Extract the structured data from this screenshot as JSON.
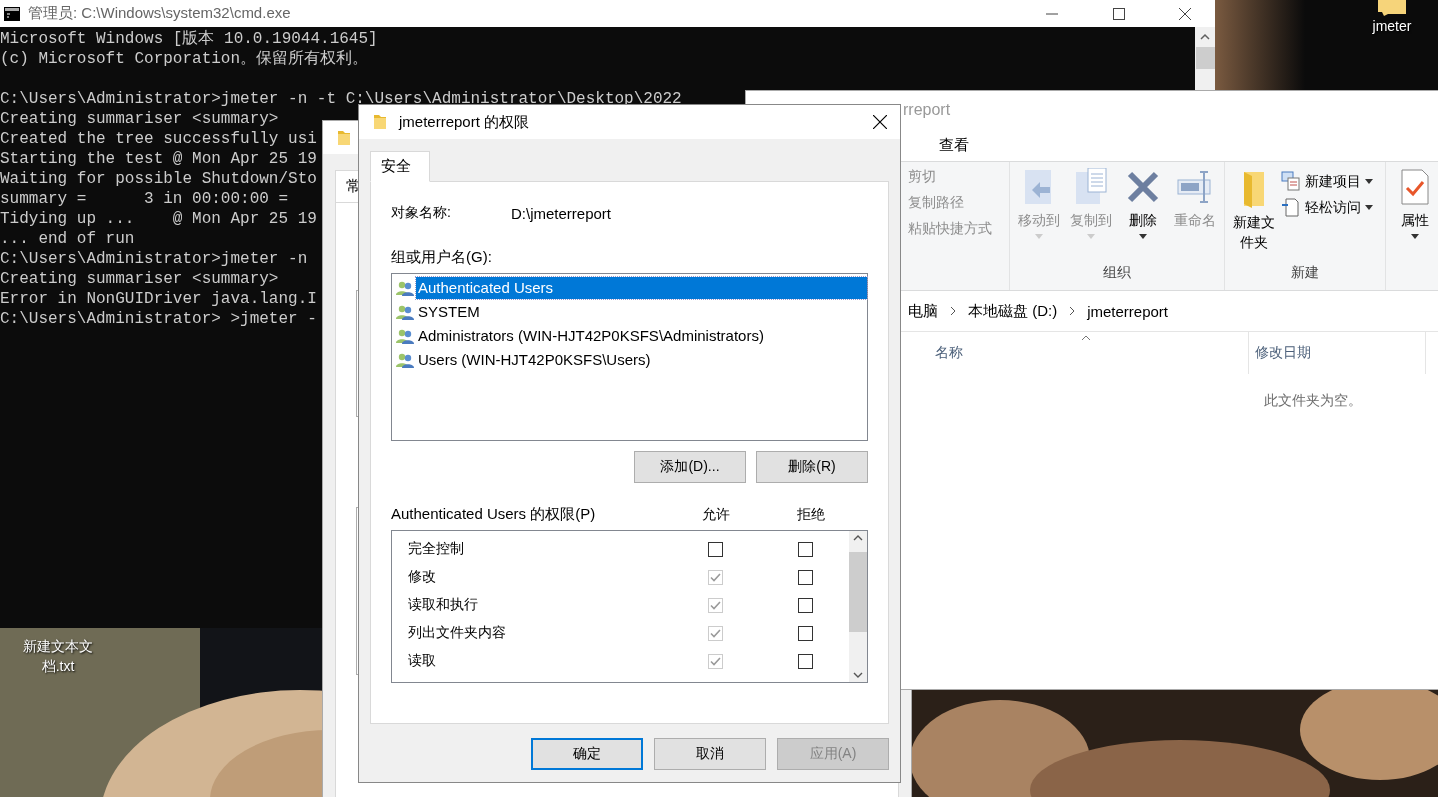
{
  "desktop": {
    "icons": [
      {
        "label": "jmeter",
        "kind": "folder"
      },
      {
        "label": "新建文本文档.txt",
        "kind": "text-file"
      }
    ]
  },
  "cmd_window": {
    "title": "管理员: C:\\Windows\\system32\\cmd.exe",
    "paragraphs": [
      [
        "Microsoft Windows [版本 10.0.19044.1645]",
        "(c) Microsoft Corporation。保留所有权利。"
      ],
      [
        "C:\\Users\\Administrator>jmeter -n -t C:\\Users\\Administrator\\Desktop\\2022",
        "Creating summariser <summary>",
        "Created the tree successfully usi",
        "Starting the test @ Mon Apr 25 19",
        "Waiting for possible Shutdown/Sto",
        "summary =      3 in 00:00:00 =",
        "Tidying up ...    @ Mon Apr 25 19",
        "... end of run",
        "C:\\Users\\Administrator>jmeter -n",
        "Creating summariser <summary>",
        "Error in NonGUIDriver java.lang.I",
        "C:\\Users\\Administrator> >jmeter -"
      ]
    ]
  },
  "properties_window": {
    "tabs": [
      {
        "label": "常",
        "selected": true
      }
    ]
  },
  "explorer_window": {
    "title": "rreport",
    "ribbon_tabs": [
      {
        "label": "查看",
        "selected": false
      }
    ],
    "clipboard_items": [
      {
        "label": "剪切",
        "disabled": true
      },
      {
        "label": "复制路径",
        "disabled": true
      },
      {
        "label": "粘贴快捷方式",
        "disabled": true
      }
    ],
    "organize": {
      "label": "组织",
      "buttons": [
        {
          "label": "移动到",
          "kind": "move",
          "disabled": true,
          "dropdown": true
        },
        {
          "label": "复制到",
          "kind": "copy",
          "disabled": true,
          "dropdown": true
        },
        {
          "label": "删除",
          "kind": "delete",
          "disabled": false,
          "dropdown": true
        },
        {
          "label": "重命名",
          "kind": "rename",
          "disabled": true,
          "dropdown": false
        }
      ]
    },
    "new_group": {
      "label": "新建",
      "large": {
        "label": "新建文件夹",
        "kind": "folder"
      },
      "small": [
        {
          "label": "新建项目",
          "kind": "new-item",
          "dropdown": true
        },
        {
          "label": "轻松访问",
          "kind": "easy-access",
          "dropdown": true
        }
      ]
    },
    "open_group": {
      "buttons": [
        {
          "label": "属性",
          "kind": "properties",
          "dropdown": true
        }
      ]
    },
    "breadcrumb": [
      "电脑",
      "本地磁盘 (D:)",
      "jmeterreport"
    ],
    "columns": [
      {
        "label": "名称",
        "sorted": true
      },
      {
        "label": "修改日期",
        "sorted": false
      }
    ],
    "empty_message": "此文件夹为空。"
  },
  "permissions_dialog": {
    "title": "jmeterreport 的权限",
    "tabs": [
      {
        "label": "安全",
        "selected": true
      }
    ],
    "object_label": "对象名称:",
    "object_value": "D:\\jmeterreport",
    "principals_label": "组或用户名(G):",
    "principals": [
      {
        "name": "Authenticated Users",
        "selected": true
      },
      {
        "name": "SYSTEM",
        "selected": false
      },
      {
        "name": "Administrators (WIN-HJT42P0KSFS\\Administrators)",
        "selected": false
      },
      {
        "name": "Users (WIN-HJT42P0KSFS\\Users)",
        "selected": false
      }
    ],
    "principal_buttons": [
      {
        "label": "添加(D)..."
      },
      {
        "label": "删除(R)"
      }
    ],
    "permissions_label": "Authenticated Users 的权限(P)",
    "permission_columns": [
      "允许",
      "拒绝"
    ],
    "permissions": [
      {
        "label": "完全控制",
        "allow": {
          "checked": false,
          "disabled": false
        },
        "deny": {
          "checked": false,
          "disabled": false
        }
      },
      {
        "label": "修改",
        "allow": {
          "checked": true,
          "disabled": true
        },
        "deny": {
          "checked": false,
          "disabled": false
        }
      },
      {
        "label": "读取和执行",
        "allow": {
          "checked": true,
          "disabled": true
        },
        "deny": {
          "checked": false,
          "disabled": false
        }
      },
      {
        "label": "列出文件夹内容",
        "allow": {
          "checked": true,
          "disabled": true
        },
        "deny": {
          "checked": false,
          "disabled": false
        }
      },
      {
        "label": "读取",
        "allow": {
          "checked": true,
          "disabled": true
        },
        "deny": {
          "checked": false,
          "disabled": false
        }
      }
    ],
    "buttons": [
      {
        "label": "确定",
        "default": true,
        "disabled": false
      },
      {
        "label": "取消",
        "default": false,
        "disabled": false
      },
      {
        "label": "应用(A)",
        "default": false,
        "disabled": true
      }
    ]
  }
}
